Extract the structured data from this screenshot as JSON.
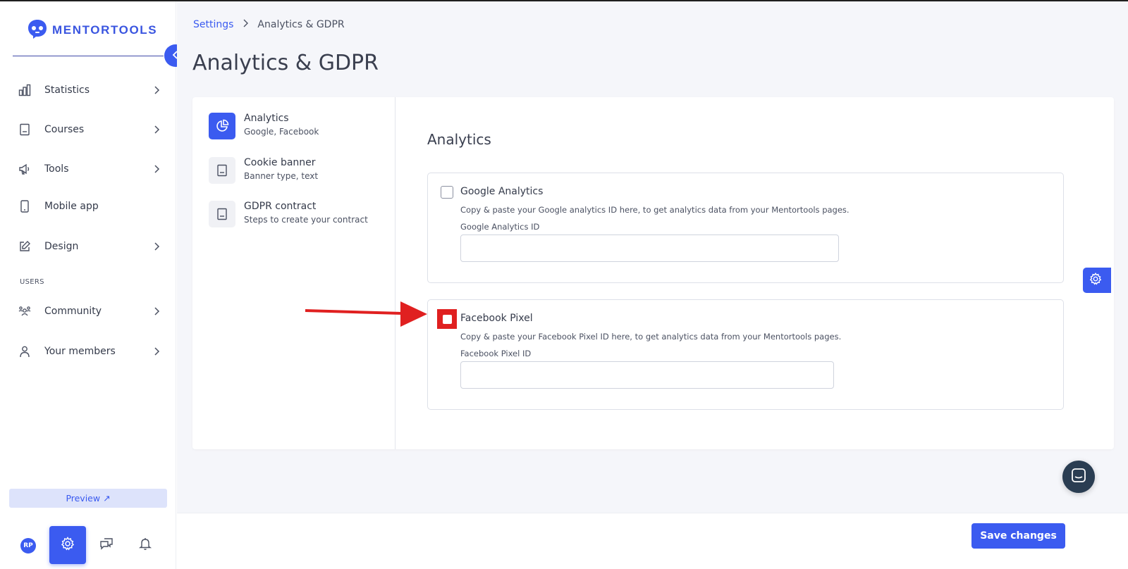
{
  "brand": {
    "name": "MENTORTOOLS",
    "accent": "#3b5bf0"
  },
  "sidebar": {
    "items": [
      {
        "label": "Statistics",
        "icon": "bar-chart-icon"
      },
      {
        "label": "Courses",
        "icon": "book-icon"
      },
      {
        "label": "Tools",
        "icon": "megaphone-icon"
      },
      {
        "label": "Mobile app",
        "icon": "mobile-icon"
      },
      {
        "label": "Design",
        "icon": "pencil-icon"
      }
    ],
    "users_section": "USERS",
    "user_items": [
      {
        "label": "Community",
        "icon": "community-icon"
      },
      {
        "label": "Your members",
        "icon": "user-icon"
      }
    ],
    "preview_label": "Preview ↗",
    "avatar_initials": "RP"
  },
  "breadcrumb": {
    "parent": "Settings",
    "current": "Analytics & GDPR"
  },
  "page_title": "Analytics & GDPR",
  "subnav": [
    {
      "title": "Analytics",
      "desc": "Google, Facebook"
    },
    {
      "title": "Cookie banner",
      "desc": "Banner type, text"
    },
    {
      "title": "GDPR contract",
      "desc": "Steps to create your contract"
    }
  ],
  "content": {
    "title": "Analytics",
    "google": {
      "title": "Google Analytics",
      "desc": "Copy & paste your Google analytics ID here, to get analytics data from your Mentortools pages.",
      "label": "Google Analytics ID",
      "value": ""
    },
    "facebook": {
      "title": "Facebook Pixel",
      "desc": "Copy & paste your Facebook Pixel ID here, to get analytics data from your Mentortools pages.",
      "label": "Facebook Pixel ID",
      "value": ""
    }
  },
  "footer": {
    "save_label": "Save changes"
  }
}
